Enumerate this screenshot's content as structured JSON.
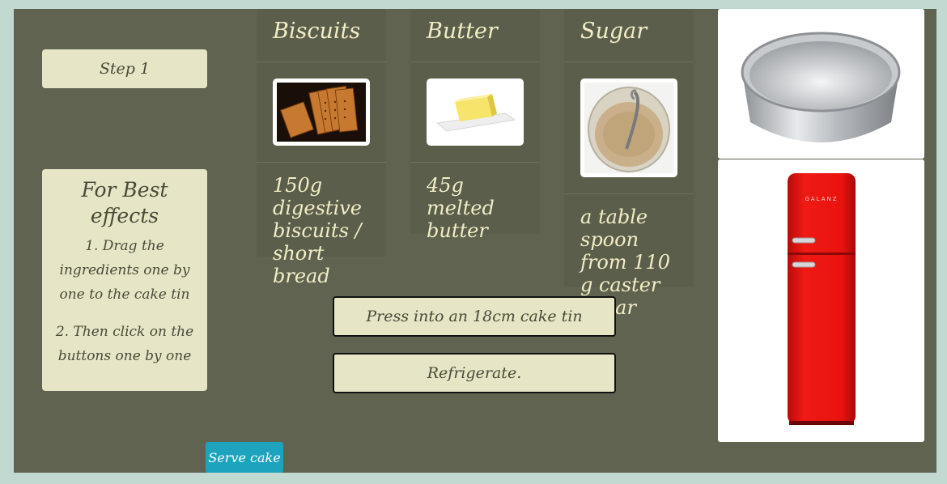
{
  "sidebar": {
    "step_label": "Step 1",
    "tips_title": "For Best effects",
    "tip_1": "1. Drag the ingredients one by one to the cake tin",
    "tip_2": "2. Then click on the buttons one by one"
  },
  "ingredients": [
    {
      "name": "Biscuits",
      "description": "150g digestive biscuits / short bread",
      "icon": "biscuits-image"
    },
    {
      "name": "Butter",
      "description": "45g melted butter",
      "icon": "butter-image"
    },
    {
      "name": "Sugar",
      "description": "a table spoon from 110 g caster sugar",
      "icon": "sugar-jar-image"
    }
  ],
  "actions": {
    "press_label": "Press into an 18cm cake tin",
    "refrigerate_label": "Refrigerate.",
    "serve_label": "Serve cake"
  },
  "images": {
    "cake_tin": "cake-tin-image",
    "fridge": "red-fridge-image",
    "fridge_brand": "GALANZ"
  },
  "colors": {
    "background": "#c2d9d2",
    "stage": "#5f634f",
    "card": "#5b5e4b",
    "button": "#e6e6c6",
    "serve": "#1ea3be",
    "fridge": "#e8120f"
  }
}
